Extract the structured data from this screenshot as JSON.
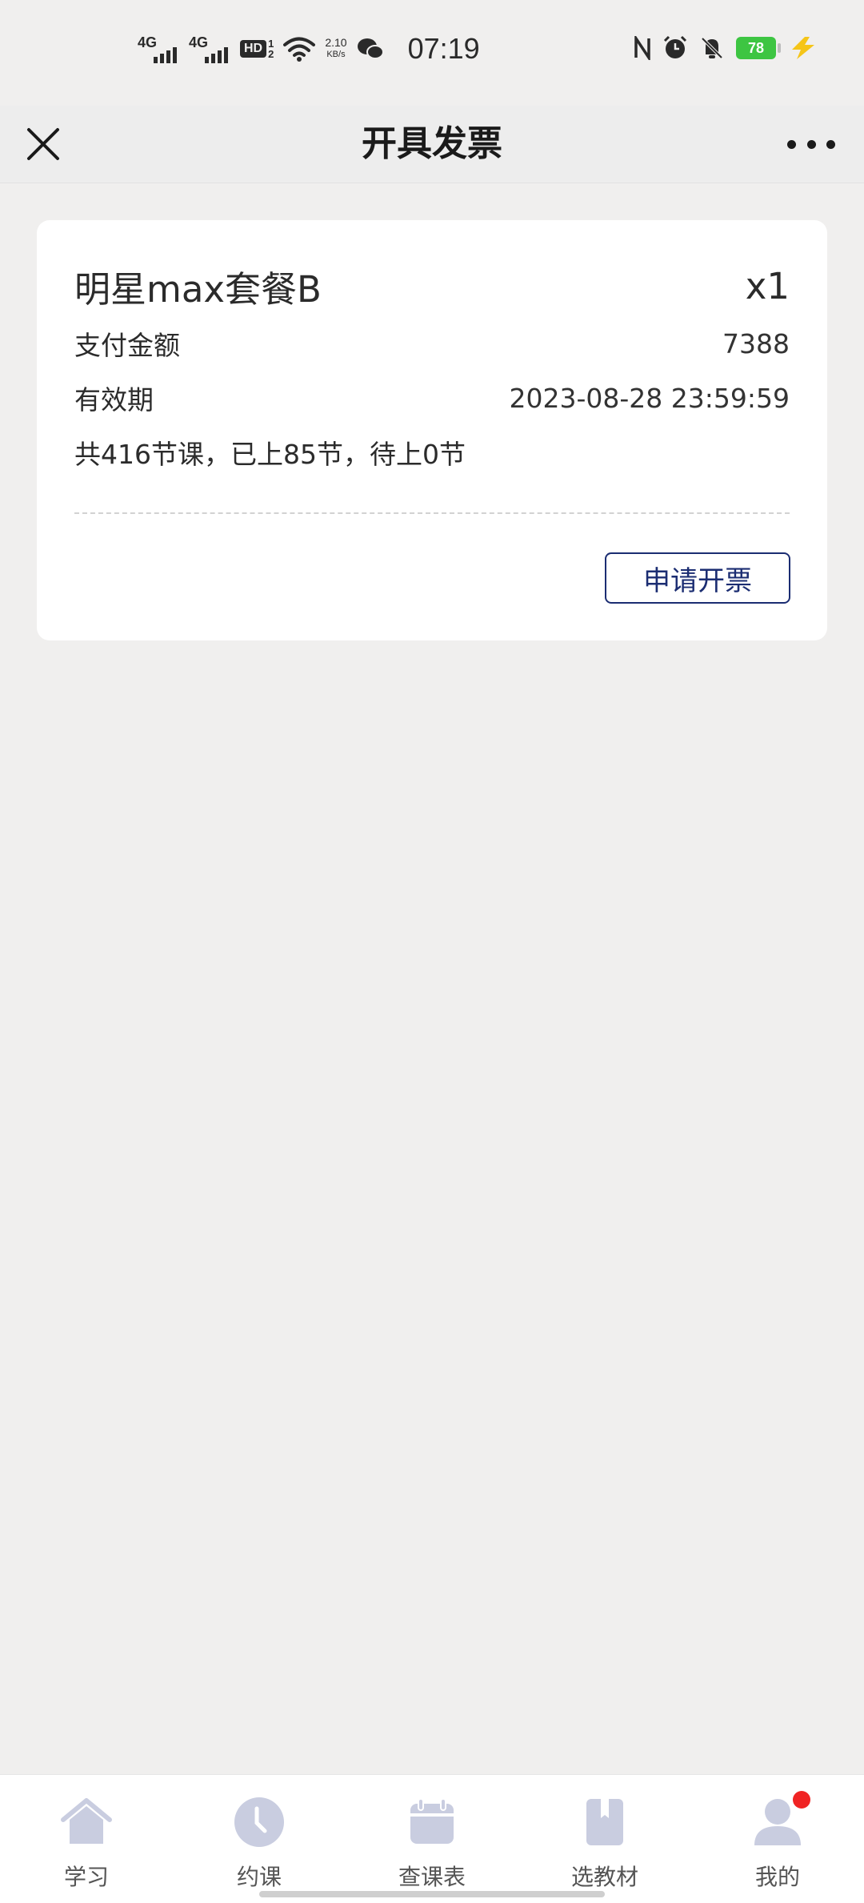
{
  "status_bar": {
    "signal1": "4G",
    "signal2": "4G",
    "hd": "HD",
    "hd_num1": "1",
    "hd_num2": "2",
    "speed_value": "2.10",
    "speed_unit": "KB/s",
    "time": "07:19",
    "battery": "78"
  },
  "title_bar": {
    "title": "开具发票"
  },
  "order": {
    "package_name": "明星max套餐B",
    "quantity": "x1",
    "amount_label": "支付金额",
    "amount_value": "7388",
    "validity_label": "有效期",
    "validity_value": "2023-08-28 23:59:59",
    "lessons": "共416节课，已上85节，待上0节",
    "apply_button": "申请开票"
  },
  "bottom_nav": {
    "items": [
      {
        "label": "学习",
        "icon": "home-icon"
      },
      {
        "label": "约课",
        "icon": "clock-icon"
      },
      {
        "label": "查课表",
        "icon": "calendar-icon"
      },
      {
        "label": "选教材",
        "icon": "book-icon"
      },
      {
        "label": "我的",
        "icon": "user-icon"
      }
    ],
    "icon_color": "#c9cde0",
    "badge_color": "#f02424"
  },
  "colors": {
    "accent": "#1b2d72",
    "battery": "#3dc542",
    "charging": "#f5c518"
  }
}
